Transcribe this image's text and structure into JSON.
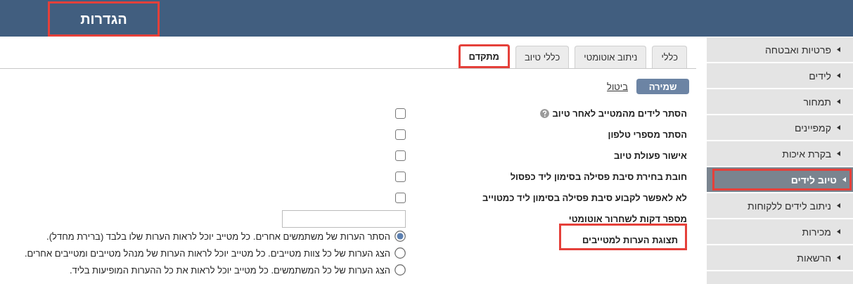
{
  "header": {
    "title": "הגדרות",
    "highlighted": true
  },
  "tabs": [
    {
      "label": "כללי",
      "selected": false,
      "highlighted": false
    },
    {
      "label": "ניתוב אוטומטי",
      "selected": false,
      "highlighted": false
    },
    {
      "label": "כללי טיוב",
      "selected": false,
      "highlighted": false
    },
    {
      "label": "מתקדם",
      "selected": true,
      "highlighted": true
    }
  ],
  "actions": {
    "save": "שמירה",
    "cancel": "ביטול"
  },
  "settings": [
    {
      "kind": "checkbox",
      "label": "הסתר לידים מהמטייב לאחר טיוב",
      "help": true,
      "checked": false,
      "highlighted": false
    },
    {
      "kind": "checkbox",
      "label": "הסתר מספרי טלפון",
      "help": false,
      "checked": false,
      "highlighted": false
    },
    {
      "kind": "checkbox",
      "label": "אישור פעולת טיוב",
      "help": false,
      "checked": false,
      "highlighted": false
    },
    {
      "kind": "checkbox",
      "label": "חובת בחירת סיבת פסילה בסימון ליד כפסול",
      "help": false,
      "checked": false,
      "highlighted": false
    },
    {
      "kind": "checkbox",
      "label": "לא לאפשר לקבוע סיבת פסילה בסימון ליד כמטוייב",
      "help": false,
      "checked": false,
      "highlighted": false
    },
    {
      "kind": "number",
      "label": "מספר דקות לשחרור אוטומטי",
      "help": false,
      "highlighted": false
    },
    {
      "kind": "radio",
      "label": "תצוגת הערות למטייבים",
      "help": false,
      "highlighted": true,
      "options": [
        {
          "label": "הסתר הערות של משתמשים אחרים. כל מטייב יוכל לראות הערות שלו בלבד (ברירת מחדל).",
          "selected": true
        },
        {
          "label": "הצג הערות של כל צוות מטייבים. כל מטייב יוכל לראות הערות של מנהל מטייבים ומטייבים אחרים.",
          "selected": false
        },
        {
          "label": "הצג הערות של כל המשתמשים. כל מטייב יוכל לראות את כל ההערות המופיעות בליד.",
          "selected": false
        }
      ]
    }
  ],
  "sidebar": {
    "items": [
      {
        "label": "פרטיות ואבטחה",
        "selected": false,
        "highlighted": false
      },
      {
        "label": "לידים",
        "selected": false,
        "highlighted": false
      },
      {
        "label": "תמחור",
        "selected": false,
        "highlighted": false
      },
      {
        "label": "קמפיינים",
        "selected": false,
        "highlighted": false
      },
      {
        "label": "בקרת איכות",
        "selected": false,
        "highlighted": false
      },
      {
        "label": "טיוב לידים",
        "selected": true,
        "highlighted": true
      },
      {
        "label": "ניתוב לידים ללקוחות",
        "selected": false,
        "highlighted": false
      },
      {
        "label": "מכירות",
        "selected": false,
        "highlighted": false
      },
      {
        "label": "הרשאות",
        "selected": false,
        "highlighted": false
      }
    ]
  }
}
